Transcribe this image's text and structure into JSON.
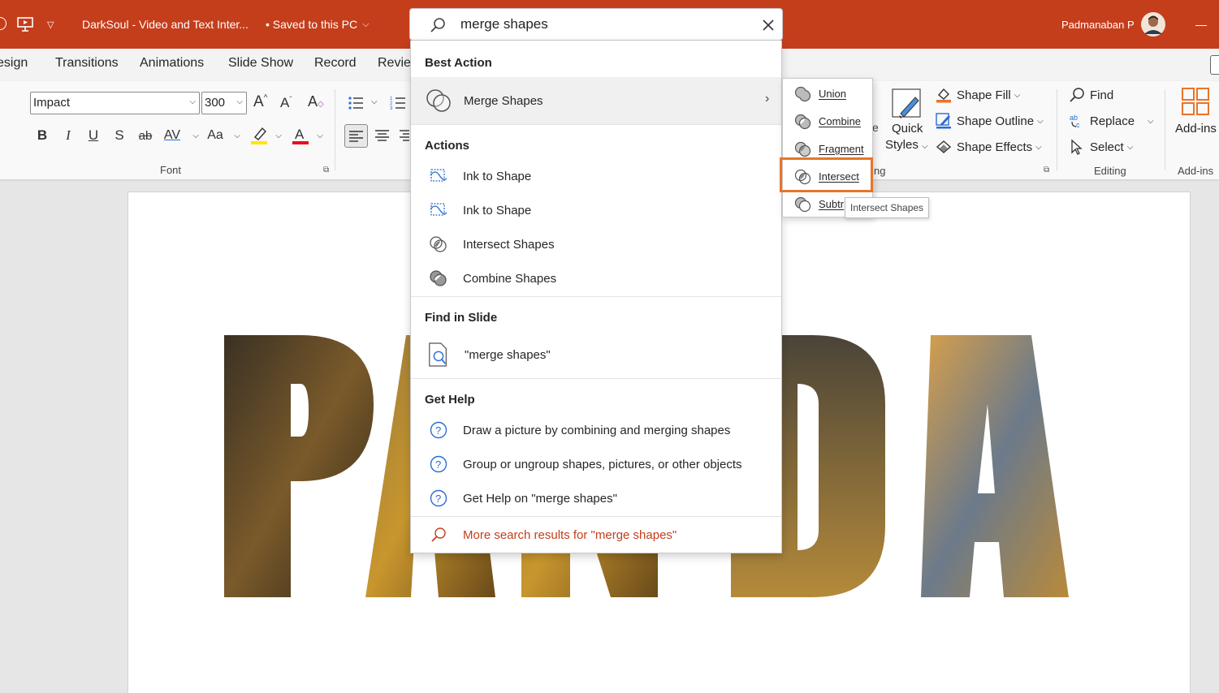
{
  "titlebar": {
    "doc_title": "DarkSoul - Video and Text Inter...",
    "save_state": "• Saved to this PC",
    "user_name": "Padmanaban P",
    "minimize": "—",
    "bg_color": "#c43e1c"
  },
  "search": {
    "query": "merge shapes",
    "best_action_heading": "Best Action",
    "best_action_label": "Merge Shapes",
    "actions_heading": "Actions",
    "actions": [
      "Ink to Shape",
      "Ink to Shape",
      "Intersect Shapes",
      "Combine Shapes"
    ],
    "find_heading": "Find in Slide",
    "find_item": "\"merge shapes\"",
    "help_heading": "Get Help",
    "help_items": [
      "Draw a picture by combining and merging shapes",
      "Group or ungroup shapes, pictures, or other objects",
      "Get Help on \"merge shapes\""
    ],
    "more_results": "More search results for \"merge shapes\"",
    "link_color": "#c43e1c"
  },
  "submenu": {
    "items": [
      "Union",
      "Combine",
      "Fragment",
      "Intersect",
      "Subtr"
    ],
    "tooltip": "Intersect Shapes",
    "highlight_color": "#e8742a"
  },
  "tabs": [
    "esign",
    "Transitions",
    "Animations",
    "Slide Show",
    "Record",
    "Revie"
  ],
  "ribbon": {
    "font_name": "Impact",
    "font_size": "300",
    "font_group_label": "Font",
    "drawing_partial_label": "ng",
    "drawing_partial_e": "e",
    "quick_styles_line1": "Quick",
    "quick_styles_line2": "Styles",
    "shape_fill": "Shape Fill",
    "shape_outline": "Shape Outline",
    "shape_effects": "Shape Effects",
    "find": "Find",
    "replace": "Replace",
    "select": "Select",
    "editing_label": "Editing",
    "addins": "Add-ins",
    "addins_label": "Add-ins",
    "bold": "B",
    "italic": "I",
    "underline": "U",
    "strike": "S",
    "ab": "ab",
    "av": "AV",
    "aa": "Aa"
  },
  "slide": {
    "word": "PANDA"
  }
}
